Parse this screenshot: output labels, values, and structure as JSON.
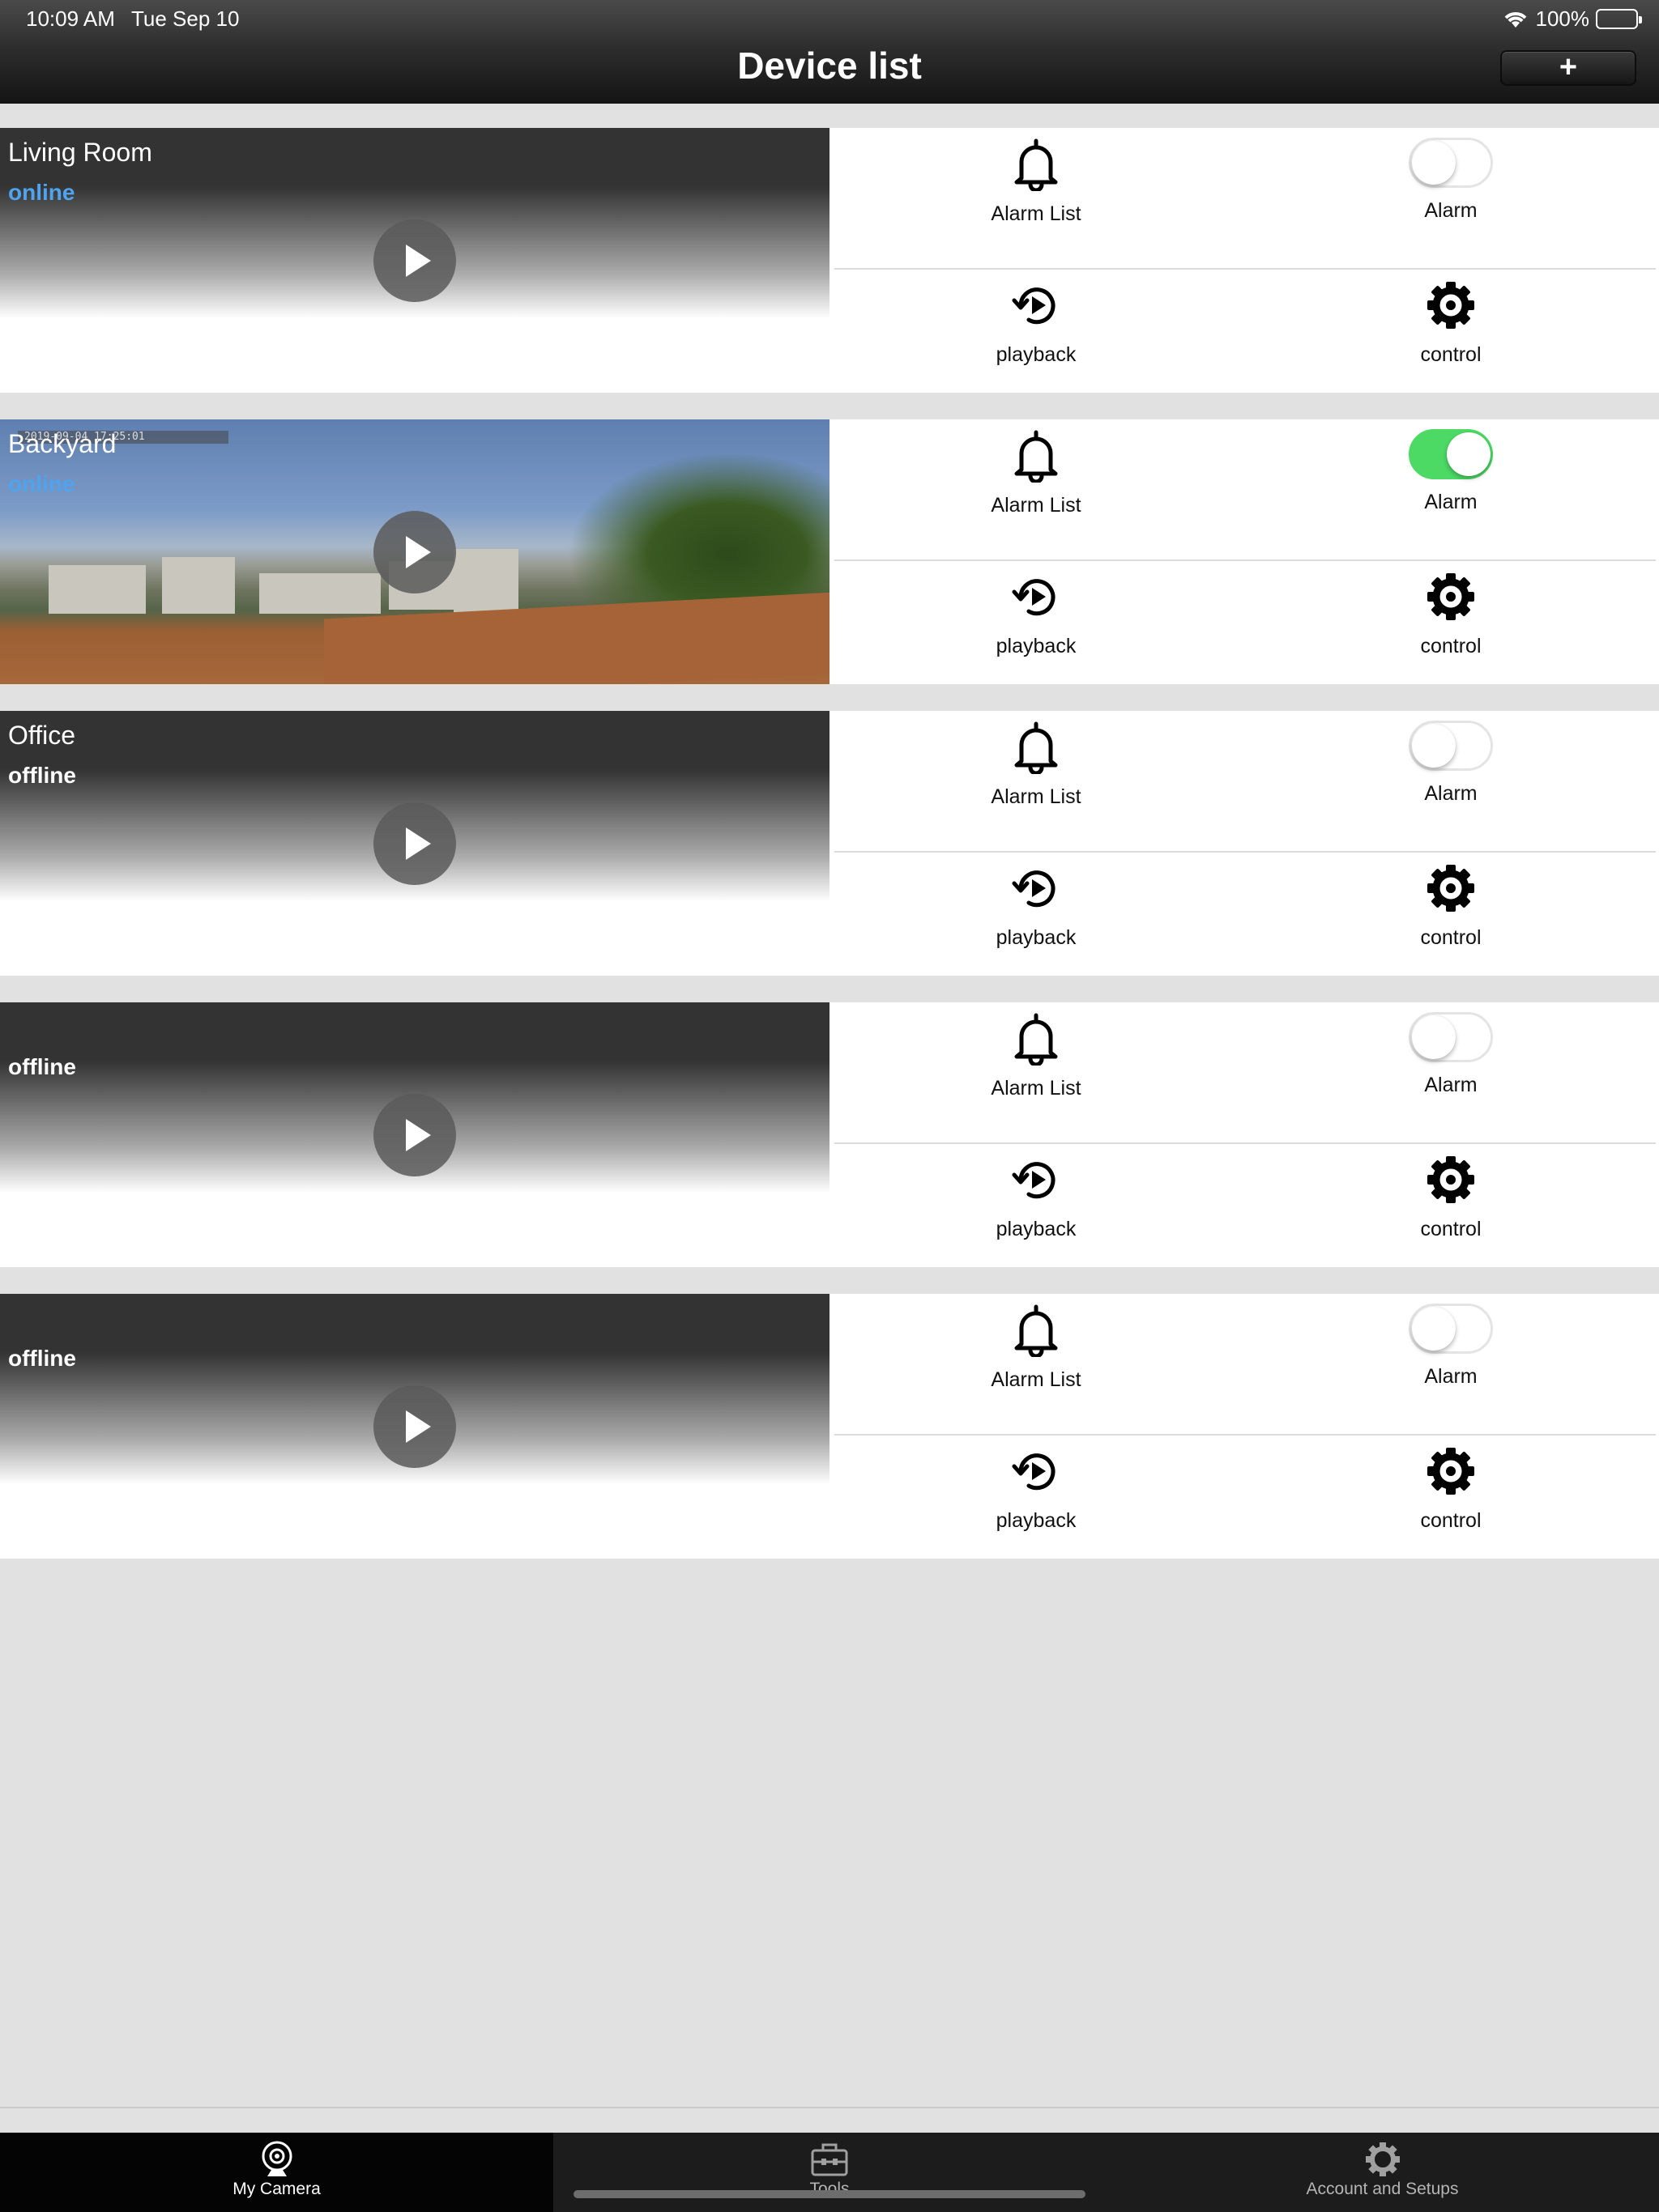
{
  "status_bar": {
    "time": "10:09 AM",
    "date": "Tue Sep 10",
    "battery": "100%"
  },
  "header": {
    "title": "Device list",
    "add_label": "+"
  },
  "devices": [
    {
      "name": "Living Room",
      "status": "online",
      "alarm_enabled": false,
      "actions": {
        "alarm_list": "Alarm List",
        "alarm": "Alarm",
        "playback": "playback",
        "control": "control"
      }
    },
    {
      "name": "Backyard",
      "status": "online",
      "alarm_enabled": true,
      "preview_timestamp": "2019-09-04 17:25:01",
      "actions": {
        "alarm_list": "Alarm List",
        "alarm": "Alarm",
        "playback": "playback",
        "control": "control"
      }
    },
    {
      "name": "Office",
      "status": "offline",
      "alarm_enabled": false,
      "actions": {
        "alarm_list": "Alarm List",
        "alarm": "Alarm",
        "playback": "playback",
        "control": "control"
      }
    },
    {
      "name": "",
      "status": "offline",
      "alarm_enabled": false,
      "actions": {
        "alarm_list": "Alarm List",
        "alarm": "Alarm",
        "playback": "playback",
        "control": "control"
      }
    },
    {
      "name": "",
      "status": "offline",
      "alarm_enabled": false,
      "actions": {
        "alarm_list": "Alarm List",
        "alarm": "Alarm",
        "playback": "playback",
        "control": "control"
      }
    }
  ],
  "tabs": [
    {
      "label": "My Camera",
      "icon": "webcam-icon",
      "active": true
    },
    {
      "label": "Tools",
      "icon": "toolbox-icon",
      "active": false
    },
    {
      "label": "Account and Setups",
      "icon": "gear-icon",
      "active": false
    }
  ],
  "colors": {
    "online": "#4fa3ef",
    "toggle_on": "#4cd964",
    "header_dark": "#141414",
    "background": "#e1e1e1"
  }
}
